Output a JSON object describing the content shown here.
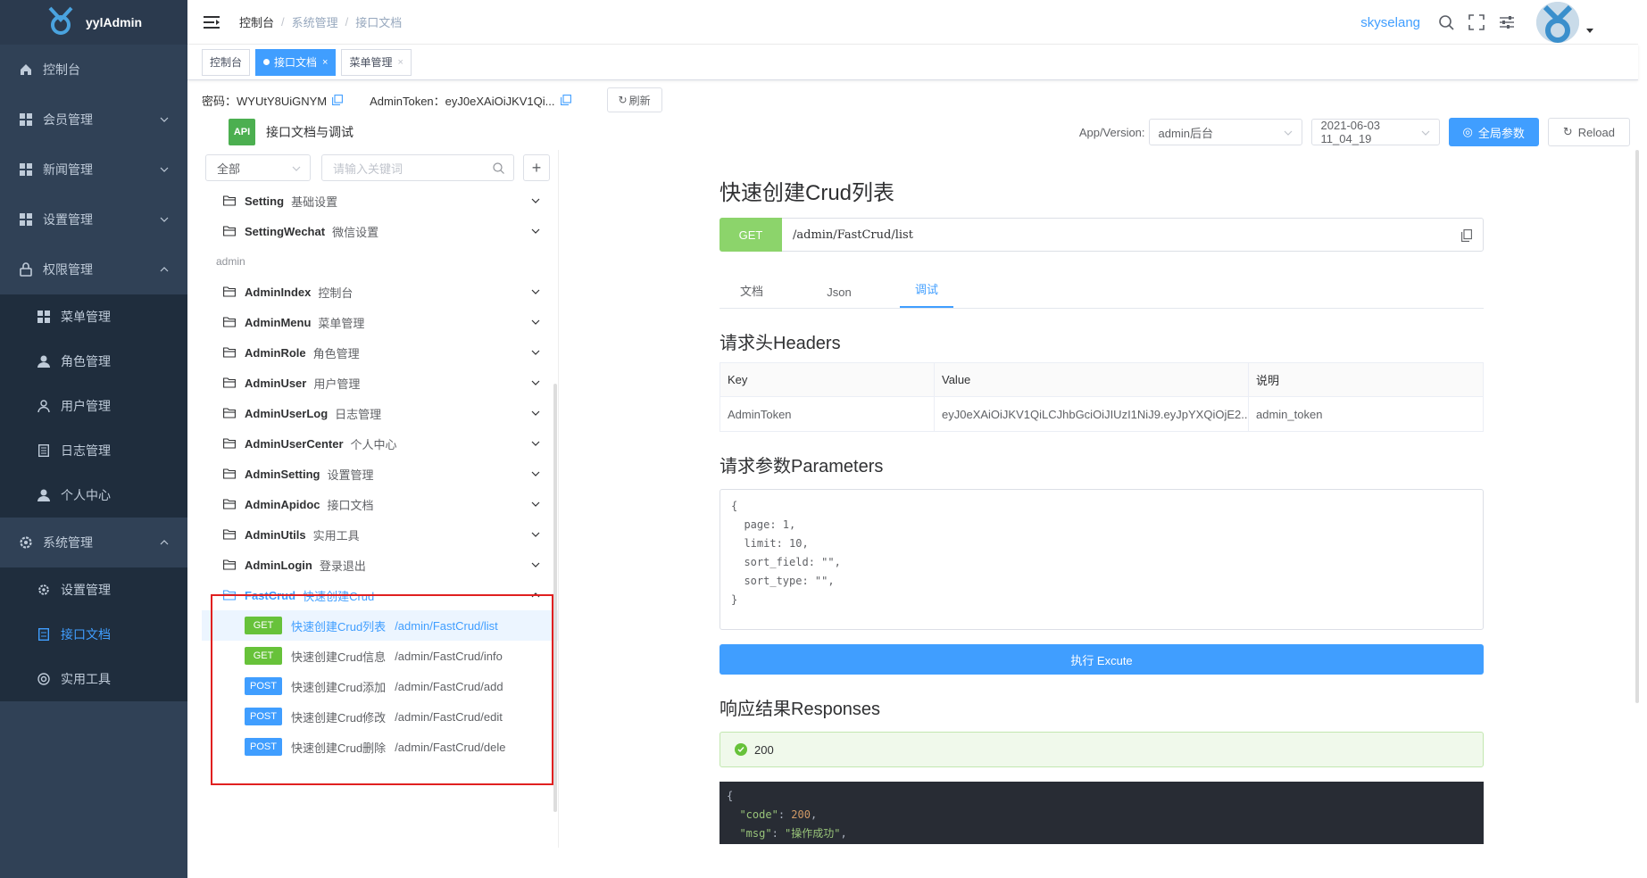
{
  "app": {
    "name": "yylAdmin"
  },
  "sidebar": {
    "items": [
      {
        "label": "控制台",
        "icon": "home-icon"
      },
      {
        "label": "会员管理",
        "icon": "grid-icon"
      },
      {
        "label": "新闻管理",
        "icon": "grid-icon"
      },
      {
        "label": "设置管理",
        "icon": "grid-icon"
      },
      {
        "label": "权限管理",
        "icon": "lock-icon"
      }
    ],
    "permission_sub": [
      {
        "label": "菜单管理",
        "icon": "grid-icon"
      },
      {
        "label": "角色管理",
        "icon": "user-icon"
      },
      {
        "label": "用户管理",
        "icon": "user-outline-icon"
      },
      {
        "label": "日志管理",
        "icon": "document-icon"
      },
      {
        "label": "个人中心",
        "icon": "user-icon"
      }
    ],
    "system": {
      "label": "系统管理",
      "icon": "gear-icon"
    },
    "system_sub": [
      {
        "label": "设置管理",
        "icon": "gear-icon"
      },
      {
        "label": "接口文档",
        "icon": "document-icon",
        "active": true
      },
      {
        "label": "实用工具",
        "icon": "tool-icon"
      }
    ]
  },
  "header": {
    "breadcrumb": [
      "控制台",
      "系统管理",
      "接口文档"
    ],
    "separator": "/",
    "username": "skyselang"
  },
  "tags": [
    {
      "label": "控制台"
    },
    {
      "label": "接口文档",
      "active": true,
      "close": "×"
    },
    {
      "label": "菜单管理",
      "close": "×"
    }
  ],
  "infobar": {
    "password": "密码：WYUtY8UiGNYM",
    "token": "AdminToken：eyJ0eXAiOiJKV1Qi...",
    "refresh_label": "刷新"
  },
  "titlebar": {
    "logo_text": "API",
    "title": "接口文档与调试",
    "app_version_label": "App/Version:",
    "app_select": "admin后台",
    "version_select": "2021-06-03 11_04_19",
    "global_params": "全局参数",
    "reload": "Reload"
  },
  "tree": {
    "filter": "全部",
    "search_placeholder": "请输入关键词",
    "plus": "+",
    "top_groups": [
      {
        "name": "Setting",
        "desc": "基础设置"
      },
      {
        "name": "SettingWechat",
        "desc": "微信设置"
      }
    ],
    "section": "admin",
    "groups": [
      {
        "name": "AdminIndex",
        "desc": "控制台"
      },
      {
        "name": "AdminMenu",
        "desc": "菜单管理"
      },
      {
        "name": "AdminRole",
        "desc": "角色管理"
      },
      {
        "name": "AdminUser",
        "desc": "用户管理"
      },
      {
        "name": "AdminUserLog",
        "desc": "日志管理"
      },
      {
        "name": "AdminUserCenter",
        "desc": "个人中心"
      },
      {
        "name": "AdminSetting",
        "desc": "设置管理"
      },
      {
        "name": "AdminApidoc",
        "desc": "接口文档"
      },
      {
        "name": "AdminUtils",
        "desc": "实用工具"
      },
      {
        "name": "AdminLogin",
        "desc": "登录退出"
      }
    ],
    "open_group": {
      "name": "FastCrud",
      "desc": "快速创建Crud"
    },
    "apis": [
      {
        "method": "GET",
        "title": "快速创建Crud列表",
        "path": "/admin/FastCrud/list",
        "active": true
      },
      {
        "method": "GET",
        "title": "快速创建Crud信息",
        "path": "/admin/FastCrud/info"
      },
      {
        "method": "POST",
        "title": "快速创建Crud添加",
        "path": "/admin/FastCrud/add"
      },
      {
        "method": "POST",
        "title": "快速创建Crud修改",
        "path": "/admin/FastCrud/edit"
      },
      {
        "method": "POST",
        "title": "快速创建Crud删除",
        "path": "/admin/FastCrud/dele"
      }
    ]
  },
  "doc": {
    "title": "快速创建Crud列表",
    "method": "GET",
    "url": "/admin/FastCrud/list",
    "tabs": [
      "文档",
      "Json",
      "调试"
    ],
    "active_tab": "调试",
    "headers_title": "请求头Headers",
    "headers_cols": [
      "Key",
      "Value",
      "说明"
    ],
    "headers_rows": [
      [
        "AdminToken",
        "eyJ0eXAiOiJKV1QiLCJhbGciOiJIUzI1NiJ9.eyJpYXQiOjE2...",
        "admin_token"
      ]
    ],
    "params_title": "请求参数Parameters",
    "params_body": "{\n  page: 1,\n  limit: 10,\n  sort_field: \"\",\n  sort_type: \"\",\n}",
    "exec_label": "执行 Excute",
    "responses_title": "响应结果Responses",
    "status_code": "200",
    "resp_line1": "{",
    "resp_code_key": "\"code\"",
    "resp_code_val": "200",
    "resp_msg_key": "\"msg\"",
    "resp_msg_val": "\"操作成功\""
  }
}
